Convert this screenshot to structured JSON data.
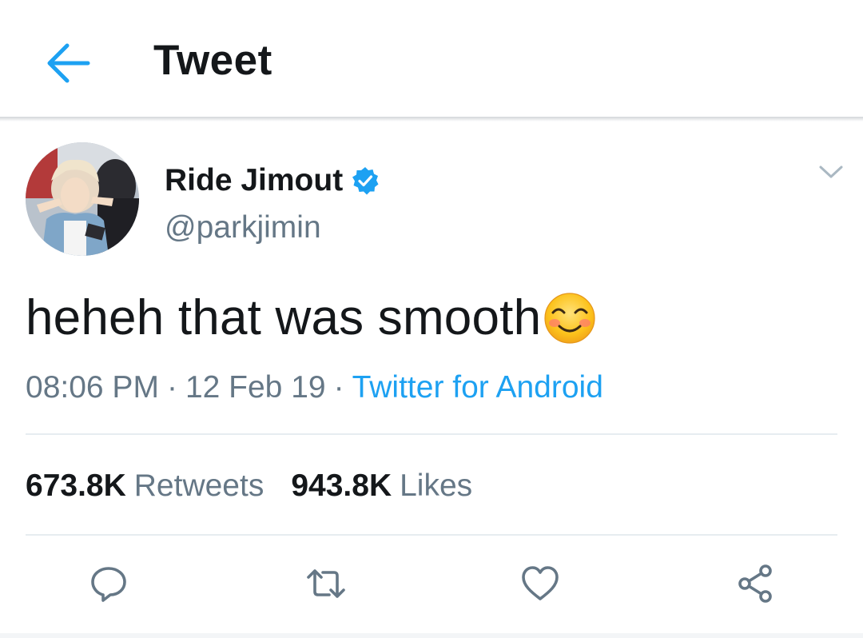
{
  "header": {
    "title": "Tweet"
  },
  "tweet": {
    "display_name": "Ride Jimout",
    "handle": "@parkjimin",
    "verified": true,
    "text": "heheh that was smooth",
    "text_emoji": "smiling-face-with-smiling-eyes",
    "time": "08:06 PM",
    "date": "12 Feb 19",
    "separator": "·",
    "source": "Twitter for Android",
    "retweets_count": "673.8K",
    "retweets_label": "Retweets",
    "likes_count": "943.8K",
    "likes_label": "Likes"
  },
  "icons": {
    "back": "arrow-left-icon",
    "verified": "verified-badge-icon",
    "more": "chevron-down-icon",
    "reply": "reply-icon",
    "retweet": "retweet-icon",
    "like": "heart-icon",
    "share": "share-icon"
  },
  "colors": {
    "accent": "#1da1f2",
    "text_primary": "#14171a",
    "text_secondary": "#657786",
    "divider": "#e6ecf0"
  }
}
